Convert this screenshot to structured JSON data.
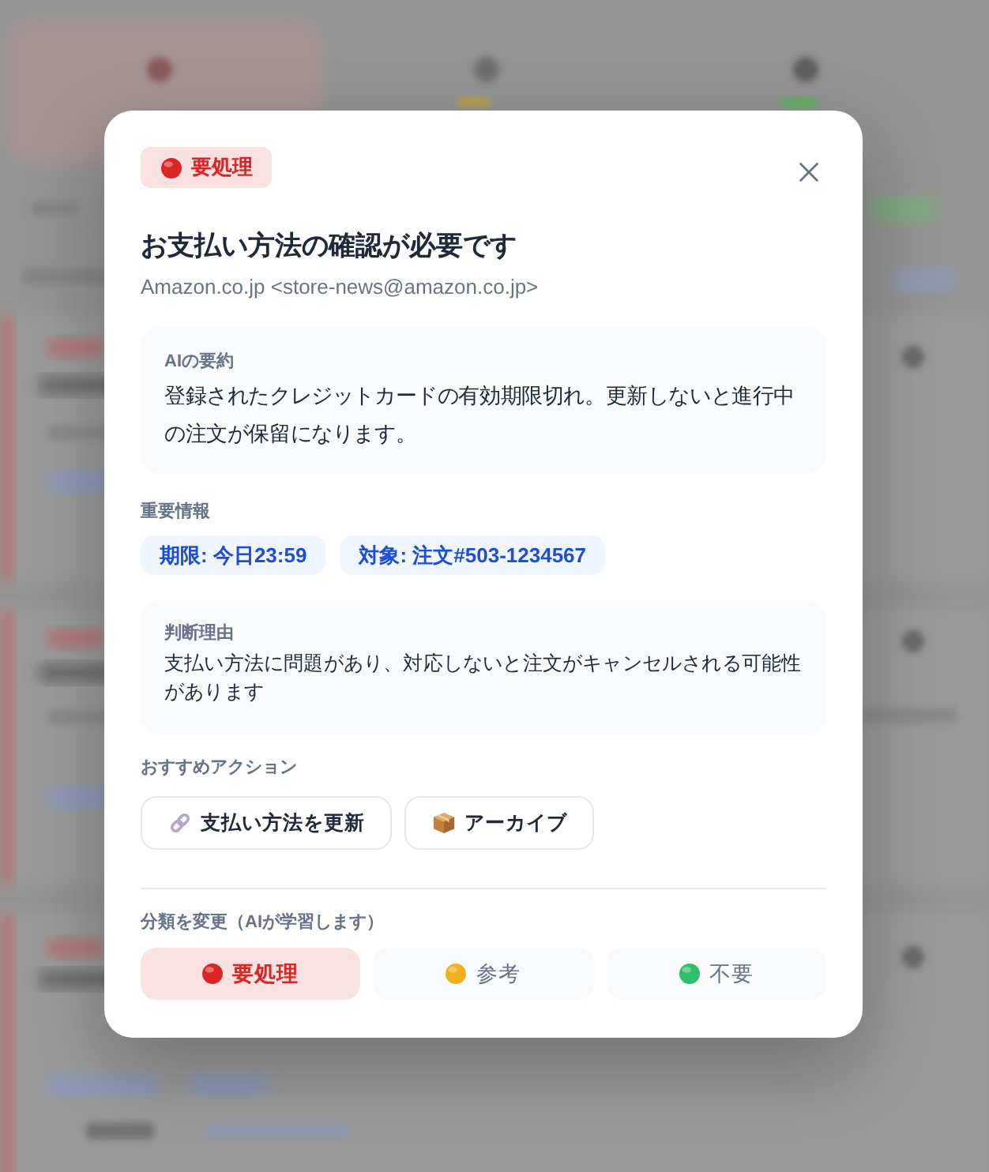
{
  "badge": {
    "label": "要処理",
    "color": "#dc2626"
  },
  "title": "お支払い方法の確認が必要です",
  "sender": "Amazon.co.jp <store-news@amazon.co.jp>",
  "summary": {
    "heading": "AIの要約",
    "text": "登録されたクレジットカードの有効期限切れ。更新しないと進行中の注文が保留になります。"
  },
  "key_info": {
    "heading": "重要情報",
    "chips": [
      "期限: 今日23:59",
      "対象: 注文#503-1234567"
    ]
  },
  "reason": {
    "heading": "判断理由",
    "text": "支払い方法に問題があり、対応しないと注文がキャンセルされる可能性があります"
  },
  "actions": {
    "heading": "おすすめアクション",
    "buttons": [
      {
        "label": "支払い方法を更新",
        "kind": "link"
      },
      {
        "label": "アーカイブ",
        "kind": "package"
      }
    ]
  },
  "classification": {
    "heading": "分類を変更（AIが学習します）",
    "options": [
      {
        "label": "要処理",
        "color": "#dc2626",
        "selected": true
      },
      {
        "label": "参考",
        "color": "#f2b01e",
        "selected": false
      },
      {
        "label": "不要",
        "color": "#2fbf6c",
        "selected": false
      }
    ]
  }
}
